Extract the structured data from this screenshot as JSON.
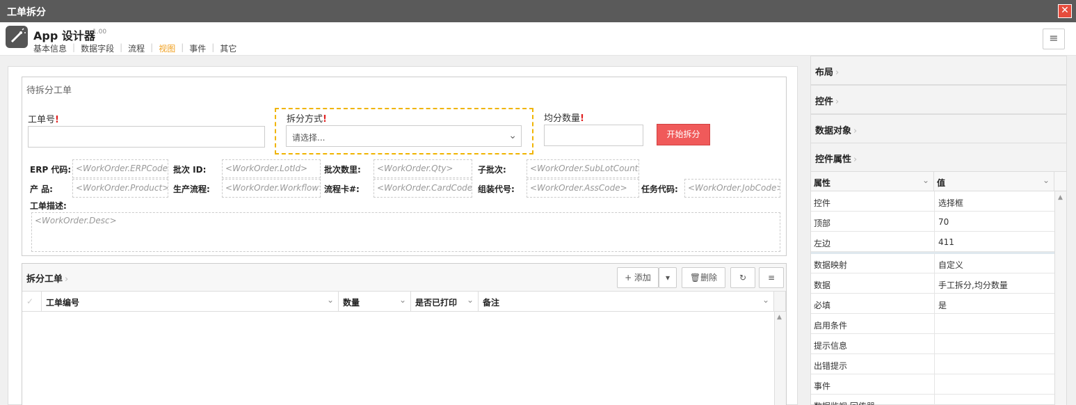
{
  "window": {
    "title": "工单拆分",
    "close_glyph": "✕"
  },
  "app": {
    "name": "App 设计器",
    "version": "1.00",
    "menu_glyph": "≡"
  },
  "menu": [
    {
      "label": "基本信息",
      "active": false
    },
    {
      "label": "数据字段",
      "active": false
    },
    {
      "label": "流程",
      "active": false
    },
    {
      "label": "视图",
      "active": true
    },
    {
      "label": "事件",
      "active": false
    },
    {
      "label": "其它",
      "active": false
    }
  ],
  "form": {
    "fieldset_title": "待拆分工单",
    "workorder_label": "工单号",
    "split_method_label": "拆分方式",
    "split_method_placeholder": "请选择...",
    "even_qty_label": "均分数量",
    "required_mark": "!",
    "start_button": "开始拆分",
    "bindings": [
      {
        "label": "ERP 代码:",
        "value": "<WorkOrder.ERPCode>"
      },
      {
        "label": "批次 ID:",
        "value": "<WorkOrder.LotId>"
      },
      {
        "label": "批次数里:",
        "value": "<WorkOrder.Qty>"
      },
      {
        "label": "子批次:",
        "value": "<WorkOrder.SubLotCount>"
      },
      {
        "label": "产 品:",
        "value": "<WorkOrder.Product>"
      },
      {
        "label": "生产流程:",
        "value": "<WorkOrder.Workflow>"
      },
      {
        "label": "流程卡#:",
        "value": "<WorkOrder.CardCode>"
      },
      {
        "label": "组装代号:",
        "value": "<WorkOrder.AssCode>"
      },
      {
        "label": "任务代码:",
        "value": "<WorkOrder.JobCode>"
      }
    ],
    "desc_label": "工单描述:",
    "desc_value": "<WorkOrder.Desc>"
  },
  "grid": {
    "title": "拆分工单",
    "add_button": "+ 添加",
    "dropdown_glyph": "▾",
    "delete_button": "删除",
    "refresh_glyph": "↻",
    "menu_glyph": "≡",
    "columns": [
      "工单编号",
      "数量",
      "是否已打印",
      "备注"
    ],
    "check_glyph": "✓"
  },
  "right": {
    "sections": [
      "布局",
      "控件",
      "数据对象",
      "控件属性"
    ],
    "prop_header": {
      "key": "属性",
      "value": "值"
    },
    "props": [
      {
        "key": "控件",
        "value": "选择框"
      },
      {
        "key": "顶部",
        "value": "70"
      },
      {
        "key": "左边",
        "value": "411"
      },
      {
        "key": "数据映射",
        "value": "自定义"
      },
      {
        "key": "数据",
        "value": "手工拆分,均分数量"
      },
      {
        "key": "必填",
        "value": "是"
      },
      {
        "key": "启用条件",
        "value": ""
      },
      {
        "key": "提示信息",
        "value": ""
      },
      {
        "key": "出错提示",
        "value": ""
      },
      {
        "key": "事件",
        "value": ""
      },
      {
        "key": "数据监视 回传器",
        "value": ""
      }
    ]
  },
  "glyphs": {
    "chevron": "⌄",
    "arrow_right": "›",
    "scroll_up": "▲"
  }
}
